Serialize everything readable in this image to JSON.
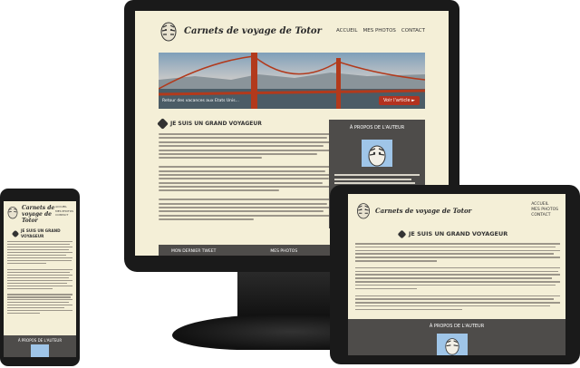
{
  "site": {
    "title": "Carnets de voyage de Totor",
    "nav": [
      "ACCUEIL",
      "MES PHOTOS",
      "CONTACT"
    ]
  },
  "banner": {
    "caption": "Retour des vacances aux Etats Unis...",
    "link": "Voir l'article ►"
  },
  "main": {
    "heading": "JE SUIS UN GRAND VOYAGEUR"
  },
  "aside": {
    "title": "À PROPOS DE L'AUTEUR"
  },
  "footer": {
    "tweet_title": "MON DERNIER TWEET",
    "photos_title": "MES PHOTOS"
  },
  "colors": {
    "background": "#f4efd7",
    "aside": "#4e4c4a",
    "accent": "#b3321f",
    "device": "#1a1a1a"
  },
  "icons": {
    "logo": "zebra-logo-icon",
    "heading": "hexagon-bullet-icon",
    "social": "facebook-icon"
  }
}
